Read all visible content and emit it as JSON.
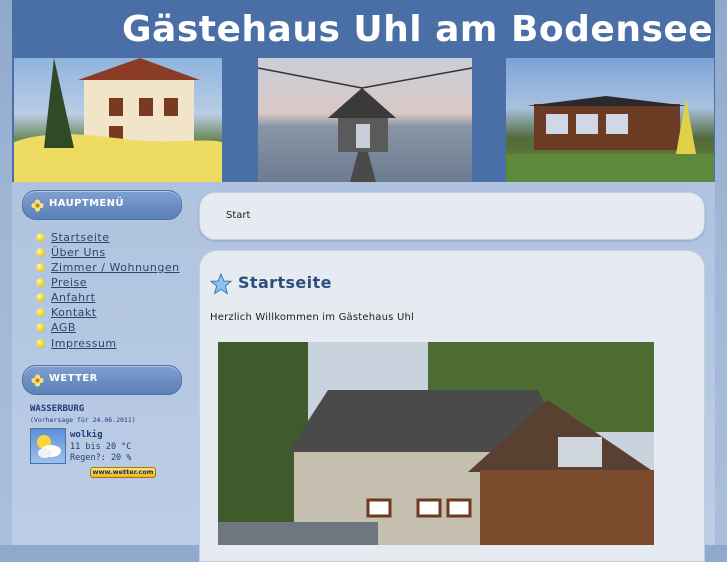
{
  "header": {
    "title": "Gästehaus Uhl am Bodensee"
  },
  "photo_strip": [
    {
      "name": "house-photo"
    },
    {
      "name": "pier-photo"
    },
    {
      "name": "cabin-photo"
    }
  ],
  "sidebar": {
    "menu_title": "HAUPTMENÜ",
    "menu_items": [
      "Startseite",
      "Über Uns",
      "Zimmer / Wohnungen",
      "Preise",
      "Anfahrt",
      "Kontakt",
      "AGB",
      "Impressum"
    ],
    "weather_title": "WETTER",
    "weather": {
      "city": "WASSERBURG",
      "forecast_date": "(Vorhersage für 24.06.2011)",
      "condition": "wolkig",
      "temperature": "11 bis 20 °C",
      "rain": "Regen?: 20 %",
      "logo": "www.wetter.com"
    }
  },
  "breadcrumb": {
    "current": "Start"
  },
  "content": {
    "title": "Startseite",
    "welcome": "Herzlich Willkommen im Gästehaus Uhl"
  },
  "colors": {
    "header_bg": "#4a6ea6",
    "menu_link": "#2a466f",
    "title_text": "#2d4f7e",
    "panel_bg": "#e6ebf1"
  }
}
